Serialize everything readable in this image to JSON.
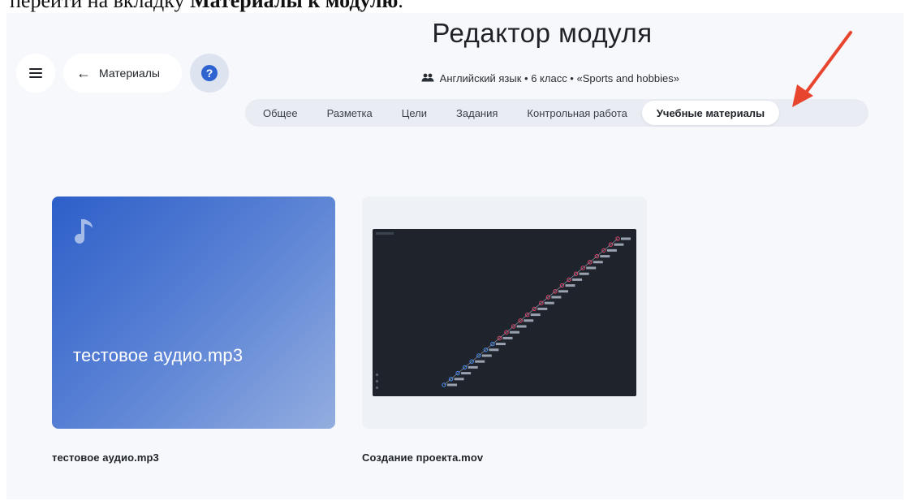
{
  "caption": {
    "prefix": "перейти на вкладку ",
    "bold": "Материалы к модулю",
    "suffix": "."
  },
  "header": {
    "back_label": "Материалы",
    "help_symbol": "?",
    "page_title": "Редактор модуля",
    "breadcrumb": "Английский язык • 6 класс • «Sports and hobbies»"
  },
  "tabs": [
    {
      "label": "Общее",
      "active": false
    },
    {
      "label": "Разметка",
      "active": false
    },
    {
      "label": "Цели",
      "active": false
    },
    {
      "label": "Задания",
      "active": false
    },
    {
      "label": "Контрольная работа",
      "active": false
    },
    {
      "label": "Учебные материалы",
      "active": true
    }
  ],
  "materials": [
    {
      "kind": "audio",
      "preview_title": "тестовое аудио.mp3",
      "file_name": "тестовое аудио.mp3",
      "icon": "music-note-icon"
    },
    {
      "kind": "video",
      "file_name": "Создание проекта.mov",
      "icon": "video-thumbnail"
    }
  ],
  "colors": {
    "accent": "#2f63d0",
    "annotation_arrow": "#e8452f",
    "audio_card_start": "#2d5fc9",
    "audio_card_end": "#93addf",
    "video_bg": "#1e232c",
    "video_node_red": "#e0466a",
    "video_node_blue": "#4a8df0"
  }
}
